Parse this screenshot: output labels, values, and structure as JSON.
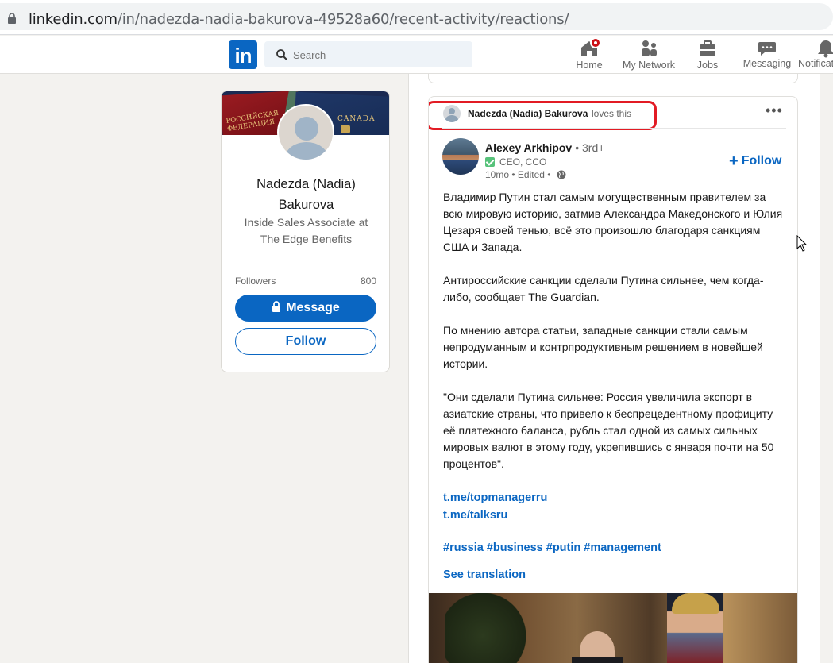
{
  "browser": {
    "url_host": "linkedin.com",
    "url_path": "/in/nadezda-nadia-bakurova-49528a60/recent-activity/reactions/"
  },
  "navbar": {
    "logo_text": "in",
    "search_placeholder": "Search",
    "items": [
      {
        "label": "Home",
        "icon": "home-icon",
        "has_badge": true
      },
      {
        "label": "My Network",
        "icon": "network-icon"
      },
      {
        "label": "Jobs",
        "icon": "briefcase-icon"
      },
      {
        "label": "Messaging",
        "icon": "messaging-icon"
      },
      {
        "label": "Notificat",
        "icon": "bell-icon"
      }
    ]
  },
  "profile": {
    "name": "Nadezda (Nadia) Bakurova",
    "headline": "Inside Sales Associate at The Edge Benefits",
    "cover_texts": {
      "left": "РОССИЙСКАЯ ФЕДЕРАЦИЯ",
      "right": "CANADA"
    },
    "followers_label": "Followers",
    "followers_count": "800",
    "message_button": "Message",
    "follow_button": "Follow"
  },
  "post": {
    "reaction": {
      "actor": "Nadezda (Nadia) Bakurova",
      "action": "loves this"
    },
    "more_label": "•••",
    "author": {
      "name": "Alexey Arkhipov",
      "degree": "• 3rd+",
      "title": "CEO, CCO",
      "meta": "10mo • Edited •"
    },
    "follow_label": "Follow",
    "paragraphs": [
      "Владимир Путин стал самым могущественным правителем за всю мировую историю, затмив Александра Македонского и Юлия Цезаря своей тенью, всё это произошло благодаря санкциям США и Запада.",
      "Антироссийские санкции сделали Путина сильнее, чем когда-либо, сообщает The Guardian.",
      "По мнению автора статьи, западные санкции стали самым непродуманным и контрпродуктивным решением в новейшей истории.",
      "\"Они сделали Путина сильнее: Россия увеличила экспорт в азиатские страны, что привело к беспрецедентному профициту её платежного баланса, рубль стал одной из самых сильных мировых валют в этому году, укрепившись с января почти на 50 процентов\"."
    ],
    "links": [
      "t.me/topmanagerru",
      "t.me/talksru"
    ],
    "hashtags": "#russia #business #putin #management",
    "see_translation": "See translation"
  },
  "colors": {
    "linkedin_blue": "#0a66c2",
    "annotation_red": "#e21b24",
    "page_bg": "#f3f2ef"
  }
}
